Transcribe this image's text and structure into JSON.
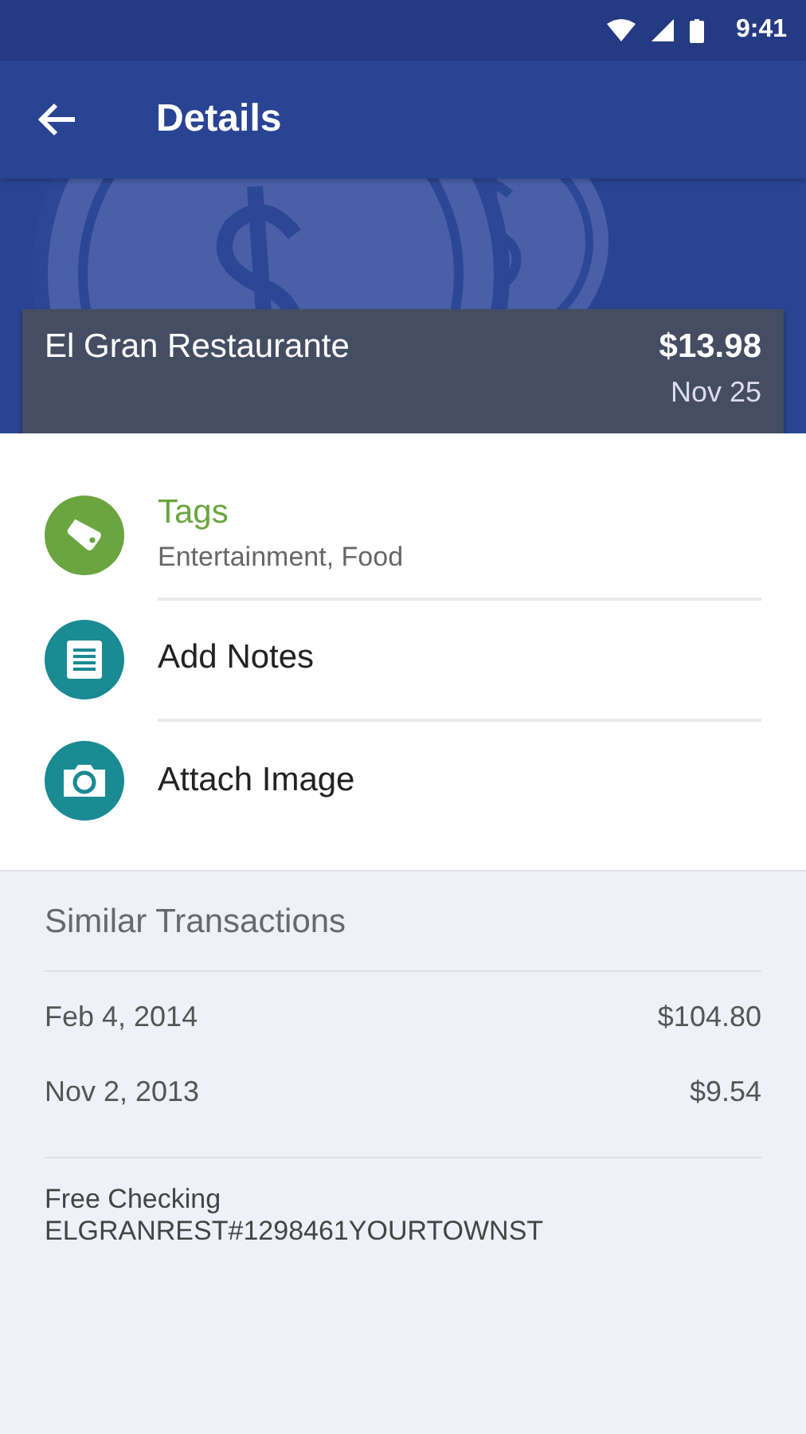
{
  "status_bar": {
    "time": "9:41"
  },
  "toolbar": {
    "title": "Details"
  },
  "transaction": {
    "merchant": "El Gran Restaurante",
    "amount": "$13.98",
    "date": "Nov 25"
  },
  "actions": [
    {
      "kind": "tag",
      "label": "Tags",
      "subtitle": "Entertainment, Food",
      "color": "#6aa53f",
      "highlighted": true
    },
    {
      "kind": "notes",
      "label": "Add Notes",
      "color": "#1a8a93",
      "highlighted": false
    },
    {
      "kind": "camera",
      "label": "Attach Image",
      "color": "#1a8a93",
      "highlighted": false
    }
  ],
  "similar": {
    "title": "Similar Transactions",
    "rows": [
      {
        "date": "Feb 4, 2014",
        "amount": "$104.80"
      },
      {
        "date": "Nov 2, 2013",
        "amount": "$9.54"
      }
    ]
  },
  "account": {
    "name": "Free Checking",
    "description": "ELGRANREST#1298461YOURTOWNST"
  }
}
